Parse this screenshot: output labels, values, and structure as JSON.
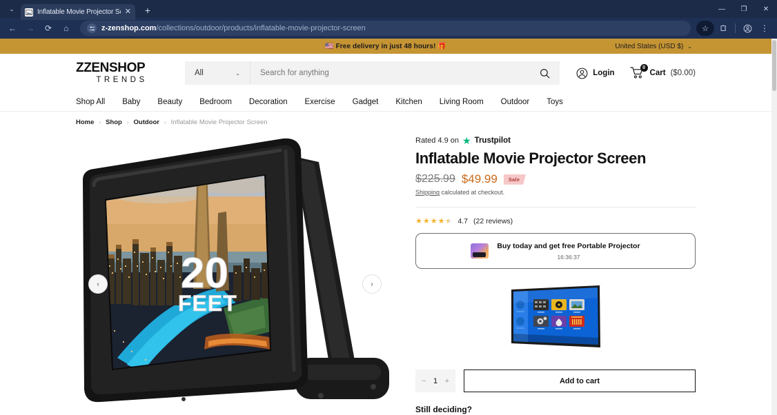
{
  "browser": {
    "tab": {
      "title": "Inflatable Movie Projector Scre",
      "close_label": "✕",
      "favicon_name": "page-favicon"
    },
    "new_tab_label": "+",
    "tab_search_label": "⌄",
    "window": {
      "minimize": "—",
      "maximize": "❐",
      "close": "✕"
    },
    "toolbar": {
      "back": "←",
      "forward": "→",
      "reload": "⟳",
      "home": "⌂",
      "url_bold": "z-zenshop.com",
      "url_rest": "/collections/outdoor/products/inflatable-movie-projector-screen",
      "site_info_icon": "tune-icon",
      "bookmark": "☆",
      "extensions": "extensions-icon",
      "profile": "profile-icon",
      "menu": "⋮"
    }
  },
  "announcement": {
    "flag": "🇺🇸",
    "text": "Free delivery in just 48 hours!",
    "gift": "🎁",
    "country": "United States (USD $)",
    "country_chevron": "⌄"
  },
  "header": {
    "logo_main": "ZZENSHOP",
    "logo_sub": "TRENDS",
    "search": {
      "category": "All",
      "category_chevron": "⌄",
      "placeholder": "Search for anything",
      "value": "",
      "button_icon": "search-icon"
    },
    "login_label": "Login",
    "cart_label": "Cart",
    "cart_price": "($0.00)",
    "cart_count": "0"
  },
  "nav": {
    "items": [
      {
        "label": "Shop All"
      },
      {
        "label": "Baby"
      },
      {
        "label": "Beauty"
      },
      {
        "label": "Bedroom"
      },
      {
        "label": "Decoration"
      },
      {
        "label": "Exercise"
      },
      {
        "label": "Gadget"
      },
      {
        "label": "Kitchen"
      },
      {
        "label": "Living Room"
      },
      {
        "label": "Outdoor"
      },
      {
        "label": "Toys"
      }
    ]
  },
  "breadcrumb": {
    "items": [
      {
        "label": "Home"
      },
      {
        "label": "Shop"
      },
      {
        "label": "Outdoor"
      }
    ],
    "separator": "›",
    "current": "Inflatable Movie Projector Screen"
  },
  "gallery": {
    "prev_label": "‹",
    "next_label": "›",
    "main_overlay_number": "20",
    "main_overlay_unit": "FEET"
  },
  "product": {
    "trustpilot_prefix": "Rated 4.9 on",
    "trustpilot_brand": "Trustpilot",
    "title": "Inflatable Movie Projector Screen",
    "price_old": "$225.99",
    "price_new": "$49.99",
    "sale_badge": "Sale",
    "shipping_link": "Shipping",
    "shipping_rest": " calculated at checkout.",
    "rating_value": "4.7",
    "rating_count": "(22 reviews)",
    "offer_title": "Buy today and get free Portable Projector",
    "offer_timer": "16:36:37",
    "qty_minus": "−",
    "qty_value": "1",
    "qty_plus": "+",
    "add_to_cart": "Add to cart",
    "still_deciding": "Still deciding?"
  },
  "colors": {
    "announcement_bg": "#c59433",
    "sale_price": "#c96a1a",
    "trustpilot_green": "#00b67a",
    "star_gold": "#f5b32e",
    "chrome_bg": "#1f3055"
  }
}
